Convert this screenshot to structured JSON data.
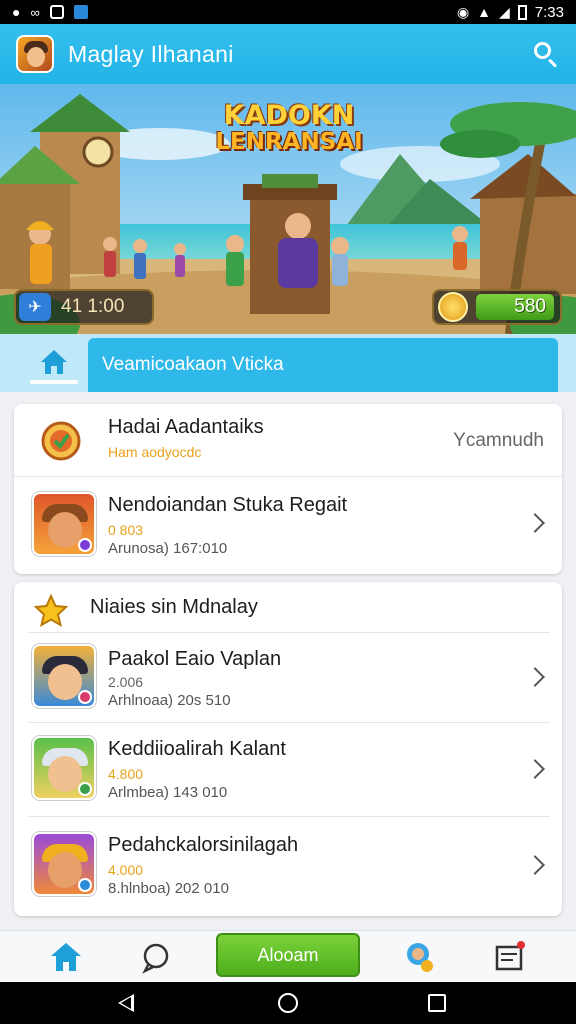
{
  "status_bar": {
    "time": "7:33"
  },
  "app_bar": {
    "title": "Maglay Ilhanani"
  },
  "banner": {
    "title_line1": "KADOKN",
    "title_line2": "LENRANSAI",
    "left_counter": "41 1:00",
    "right_counter": "580"
  },
  "tabs": {
    "active_label": "Veamicoakaon Vticka"
  },
  "card1": {
    "header": {
      "title": "Hadai Aadantaiks",
      "subtitle": "Ham aodyocdc",
      "right_label": "Ycamnudh"
    },
    "item": {
      "title": "Nendoiandan Stuka Regait",
      "price": "0 803",
      "meta": "Arunosa) 167:010"
    }
  },
  "card2": {
    "title": "Niaies sin Mdnalay",
    "items": [
      {
        "title": "Paakol Eaio Vaplan",
        "price": "2.006",
        "meta": "Arhlnoaa) 20s 510"
      },
      {
        "title": "Keddiioalirah Kalant",
        "price": "4.800",
        "meta": "Arlmbea) 143 010"
      },
      {
        "title": "Pedahckalorsinilagah",
        "price": "4.000",
        "meta": "8.hlnboa) 202 010"
      }
    ]
  },
  "bottom_nav": {
    "cta_label": "Alooam"
  },
  "colors": {
    "primary": "#22b3e6",
    "cta": "#5bbd24",
    "price": "#e8a21a"
  }
}
